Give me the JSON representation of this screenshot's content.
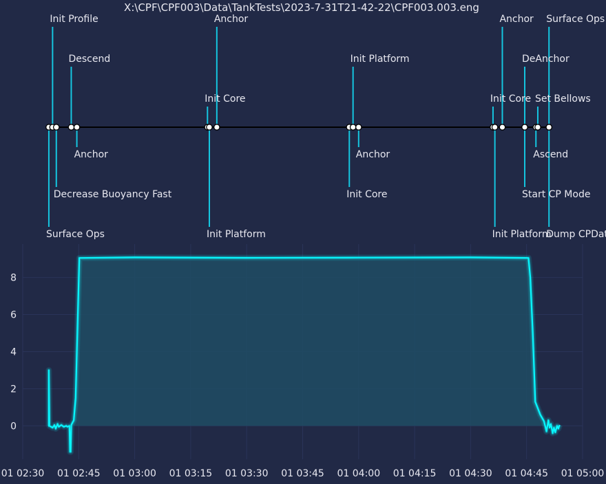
{
  "title": "X:\\CPF\\CPF003\\Data\\TankTests\\2023-7-31T21-42-22\\CPF003.003.eng",
  "colors": {
    "background": "#212946",
    "grid": "#2A3459",
    "accent": "#08F7FE",
    "stem": "#15C6E0",
    "label": "#E8E8F0",
    "fill": "#1E4C64"
  },
  "chart_data": [
    {
      "type": "timeline",
      "events": [
        {
          "time": "02:37:00",
          "label": "Surface Ops",
          "side": "below",
          "level": 3
        },
        {
          "time": "02:38:00",
          "label": "Init Profile",
          "side": "above",
          "level": 3
        },
        {
          "time": "02:39:00",
          "label": "Decrease Buoyancy Fast",
          "side": "below",
          "level": 2
        },
        {
          "time": "02:43:00",
          "label": "Descend",
          "side": "above",
          "level": 2
        },
        {
          "time": "02:44:30",
          "label": "Anchor",
          "side": "below",
          "level": 1
        },
        {
          "time": "03:19:30",
          "label": "Init Core",
          "side": "above",
          "level": 1
        },
        {
          "time": "03:20:00",
          "label": "Init Platform",
          "side": "below",
          "level": 3
        },
        {
          "time": "03:22:00",
          "label": "Anchor",
          "side": "above",
          "level": 3
        },
        {
          "time": "03:57:30",
          "label": "Init Core",
          "side": "below",
          "level": 2
        },
        {
          "time": "03:58:30",
          "label": "Init Platform",
          "side": "above",
          "level": 2
        },
        {
          "time": "04:00:00",
          "label": "Anchor",
          "side": "below",
          "level": 1
        },
        {
          "time": "04:36:00",
          "label": "Init Core",
          "side": "above",
          "level": 1
        },
        {
          "time": "04:36:30",
          "label": "Init Platform",
          "side": "below",
          "level": 3
        },
        {
          "time": "04:38:30",
          "label": "Anchor",
          "side": "above",
          "level": 3
        },
        {
          "time": "04:44:30",
          "label": "DeAnchor",
          "side": "above",
          "level": 2
        },
        {
          "time": "04:44:30",
          "label": "Start CP Mode",
          "side": "below",
          "level": 2
        },
        {
          "time": "04:47:30",
          "label": "Ascend",
          "side": "below",
          "level": 1
        },
        {
          "time": "04:48:00",
          "label": "Set Bellows",
          "side": "above",
          "level": 1
        },
        {
          "time": "04:51:00",
          "label": "Surface Ops",
          "side": "above",
          "level": 3
        },
        {
          "time": "04:51:00",
          "label": "Dump CPData",
          "side": "below",
          "level": 3
        }
      ]
    },
    {
      "type": "area",
      "x_ticks": [
        "01 02:30",
        "01 02:45",
        "01 03:00",
        "01 03:15",
        "01 03:30",
        "01 03:45",
        "01 04:00",
        "01 04:15",
        "01 04:30",
        "01 04:45",
        "01 05:00"
      ],
      "y_ticks": [
        "0",
        "2",
        "4",
        "6",
        "8"
      ],
      "xlim": [
        "02:30:00",
        "05:00:00"
      ],
      "ylim": [
        9.8,
        -1.8
      ],
      "y_inverted": true,
      "fill_to": 0,
      "series": [
        {
          "points": [
            [
              "02:36:50",
              0.0
            ],
            [
              "02:37:00",
              0.0
            ],
            [
              "02:37:00",
              3.0
            ],
            [
              "02:37:10",
              0.0
            ],
            [
              "02:38:00",
              -0.1
            ],
            [
              "02:38:30",
              0.05
            ],
            [
              "02:38:50",
              -0.15
            ],
            [
              "02:39:20",
              0.1
            ],
            [
              "02:39:40",
              -0.05
            ],
            [
              "02:40:20",
              0.05
            ],
            [
              "02:41:00",
              -0.05
            ],
            [
              "02:41:40",
              0.0
            ],
            [
              "02:42:00",
              -0.05
            ],
            [
              "02:42:30",
              0.0
            ],
            [
              "02:42:40",
              -1.4
            ],
            [
              "02:42:50",
              -1.4
            ],
            [
              "02:43:00",
              0.05
            ],
            [
              "02:43:40",
              0.3
            ],
            [
              "02:44:10",
              1.5
            ],
            [
              "02:45:10",
              9.05
            ],
            [
              "03:00:00",
              9.08
            ],
            [
              "03:30:00",
              9.06
            ],
            [
              "04:00:00",
              9.07
            ],
            [
              "04:30:00",
              9.08
            ],
            [
              "04:45:30",
              9.05
            ],
            [
              "04:46:00",
              8.0
            ],
            [
              "04:46:40",
              5.0
            ],
            [
              "04:47:20",
              1.3
            ],
            [
              "04:48:40",
              0.6
            ],
            [
              "04:49:40",
              0.25
            ],
            [
              "04:50:20",
              -0.3
            ],
            [
              "04:50:50",
              0.3
            ],
            [
              "04:51:10",
              -0.1
            ],
            [
              "04:51:30",
              0.1
            ],
            [
              "04:52:00",
              -0.4
            ],
            [
              "04:52:20",
              -0.1
            ],
            [
              "04:52:40",
              -0.35
            ],
            [
              "04:53:10",
              0.0
            ],
            [
              "04:53:30",
              -0.15
            ],
            [
              "04:53:50",
              0.05
            ]
          ]
        }
      ]
    }
  ]
}
